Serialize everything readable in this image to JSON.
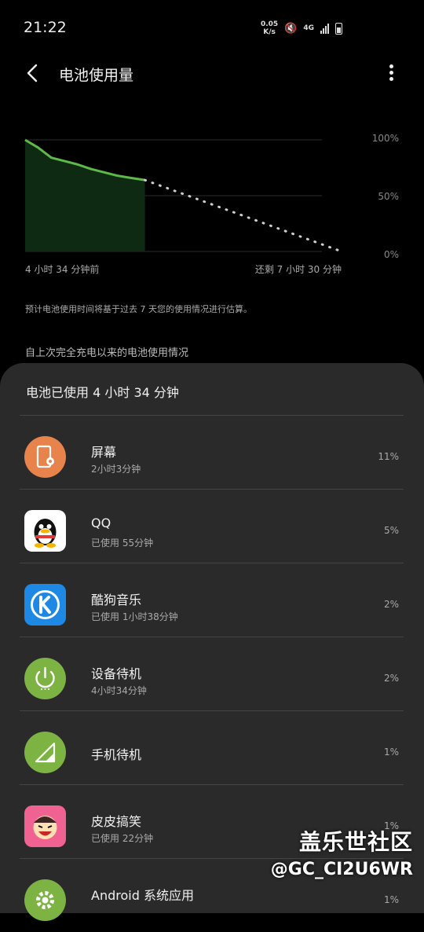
{
  "status_bar": {
    "time": "21:22",
    "net_speed": "0.05",
    "net_unit": "K/s",
    "network": "4G"
  },
  "app_bar": {
    "title": "电池使用量"
  },
  "chart_data": {
    "type": "area",
    "y_ticks": [
      "100%",
      "50%",
      "0%"
    ],
    "x_labels": {
      "start": "4 小时 34 分钟前",
      "end": "还剩 7 小时 30 分钟"
    },
    "ylim": [
      0,
      100
    ],
    "xlim": [
      0,
      12.07
    ],
    "actual": {
      "x": [
        0,
        0.5,
        1.0,
        1.5,
        2.0,
        2.5,
        3.0,
        3.5,
        4.0,
        4.57
      ],
      "y": [
        100,
        93,
        84,
        81,
        78,
        74,
        71,
        68,
        66,
        64
      ]
    },
    "projected": {
      "x": [
        4.57,
        12.07
      ],
      "y": [
        64,
        0
      ]
    }
  },
  "note": "预计电池使用时间将基于过去 7 天您的使用情况进行估算。",
  "since_label": "自上次完全充电以来的电池使用情况",
  "usage_summary": "电池已使用 4 小时 34 分钟",
  "apps": [
    {
      "name": "屏幕",
      "sub": "2小时3分钟",
      "pct": "11%",
      "icon": "screen-icon",
      "color": "#e8834b"
    },
    {
      "name": "QQ",
      "sub": "已使用 55分钟",
      "pct": "5%",
      "icon": "qq-penguin-icon",
      "color": "#ffffff"
    },
    {
      "name": "酷狗音乐",
      "sub": "已使用 1小时38分钟",
      "pct": "2%",
      "icon": "kugou-icon",
      "color": "#1e88e5"
    },
    {
      "name": "设备待机",
      "sub": "4小时34分钟",
      "pct": "2%",
      "icon": "power-icon",
      "color": "#7cb342"
    },
    {
      "name": "手机待机",
      "sub": "",
      "pct": "1%",
      "icon": "signal-icon",
      "color": "#7cb342"
    },
    {
      "name": "皮皮搞笑",
      "sub": "已使用 22分钟",
      "pct": "1%",
      "icon": "pipi-face-icon",
      "color": "#f06292"
    },
    {
      "name": "Android 系统应用",
      "sub": "",
      "pct": "1%",
      "icon": "gear-icon",
      "color": "#7cb342"
    }
  ],
  "watermark": {
    "line1": "盖乐世社区",
    "line2": "@GC_CI2U6WR"
  }
}
